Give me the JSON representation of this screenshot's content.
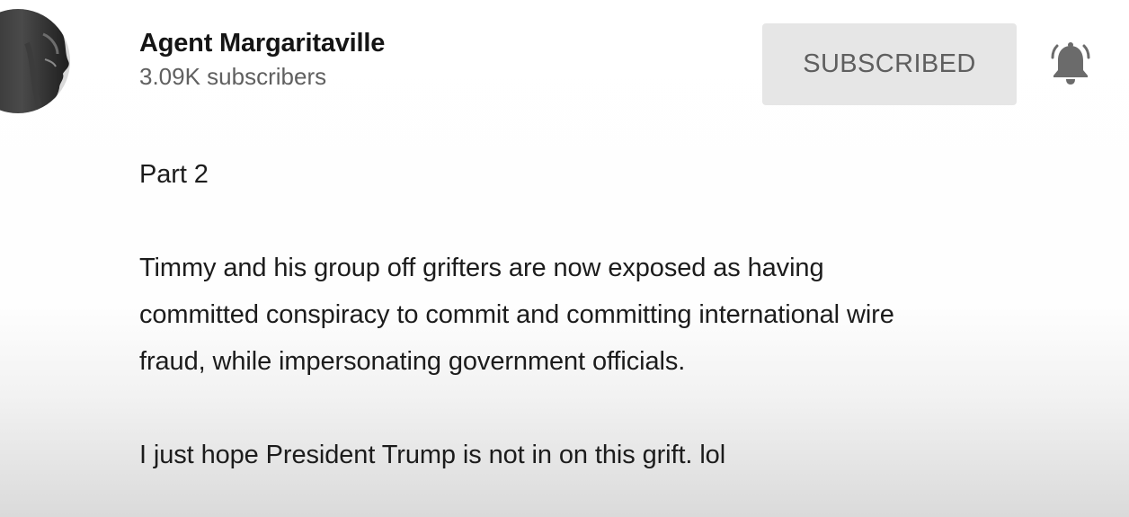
{
  "channel": {
    "name": "Agent Margaritaville",
    "subscribers": "3.09K subscribers",
    "avatar_icon": "person-profile-avatar"
  },
  "subscribe_button": {
    "label": "SUBSCRIBED",
    "bg_color": "#e6e6e6",
    "text_color": "#5f5f5f"
  },
  "notification": {
    "icon": "bell-ringing-icon"
  },
  "description": {
    "paragraphs": [
      {
        "lines": [
          "Part 2"
        ]
      },
      {
        "lines": [
          "Timmy and his group off grifters are now exposed as having",
          "committed conspiracy to commit and committing international wire",
          "fraud, while impersonating government officials."
        ]
      },
      {
        "lines": [
          "I just hope President Trump is not in on this grift. lol"
        ]
      }
    ]
  }
}
